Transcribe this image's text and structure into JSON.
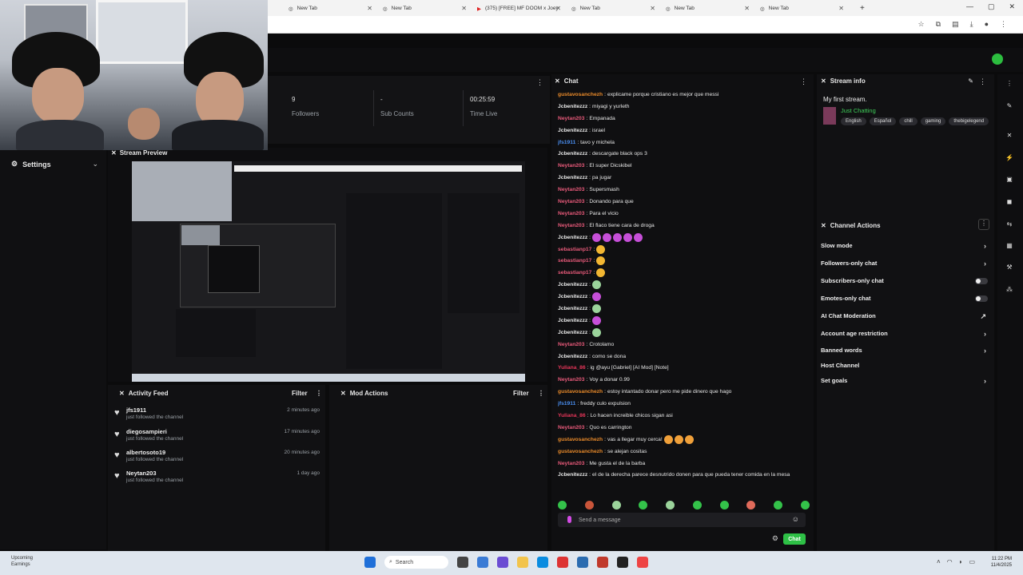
{
  "browser": {
    "tabs": [
      {
        "label": "New Tab",
        "icon": "globe-icon"
      },
      {
        "label": "New Tab",
        "icon": "globe-icon"
      },
      {
        "label": "(375) [FREE] MF DOOM x Joey",
        "icon": "youtube-icon"
      },
      {
        "label": "New Tab",
        "icon": "globe-icon"
      },
      {
        "label": "New Tab",
        "icon": "globe-icon"
      },
      {
        "label": "New Tab",
        "icon": "globe-icon"
      }
    ],
    "new_tab_symbol": "+"
  },
  "stats": {
    "followers_value": "9",
    "followers_label": "Followers",
    "subs_value": "-",
    "subs_label": "Sub Counts",
    "time_value": "00:25:59",
    "time_label": "Time Live"
  },
  "sidebar": {
    "settings_label": "Settings"
  },
  "preview": {
    "title": "Stream Preview"
  },
  "activity": {
    "title": "Activity Feed",
    "filter": "Filter",
    "items": [
      {
        "name": "jfs1911",
        "sub": "just followed the channel",
        "time": "2 minutes ago"
      },
      {
        "name": "diegosampieri",
        "sub": "just followed the channel",
        "time": "17 minutes ago"
      },
      {
        "name": "albertosoto19",
        "sub": "just followed the channel",
        "time": "20 minutes ago"
      },
      {
        "name": "Neytan203",
        "sub": "just followed the channel",
        "time": "1 day ago"
      }
    ]
  },
  "mod": {
    "title": "Mod Actions",
    "filter": "Filter"
  },
  "chat": {
    "title": "Chat",
    "placeholder": "Send a message",
    "send_label": "Chat",
    "messages": [
      {
        "user": "gustavosanchezh",
        "color": "#e98a2a",
        "text": "explicame porque cristiano es mejor que messi",
        "emotes": []
      },
      {
        "user": "Jcbenitezzz",
        "color": "#e8e8e8",
        "text": "miyagi y yurleth",
        "emotes": []
      },
      {
        "user": "Neytan203",
        "color": "#e85a7a",
        "text": "Empanada",
        "emotes": []
      },
      {
        "user": "Jcbenitezzz",
        "color": "#e8e8e8",
        "text": "israel",
        "emotes": []
      },
      {
        "user": "jfs1911",
        "color": "#4a8ef0",
        "text": "tavo y michela",
        "emotes": []
      },
      {
        "user": "Jcbenitezzz",
        "color": "#e8e8e8",
        "text": "descargate black ops 3",
        "emotes": []
      },
      {
        "user": "Neytan203",
        "color": "#e85a7a",
        "text": "El super Dicskibel",
        "emotes": []
      },
      {
        "user": "Jcbenitezzz",
        "color": "#e8e8e8",
        "text": "pa jugar",
        "emotes": []
      },
      {
        "user": "Neytan203",
        "color": "#e85a7a",
        "text": "Supersmash",
        "emotes": []
      },
      {
        "user": "Neytan203",
        "color": "#e85a7a",
        "text": "Donando para que",
        "emotes": []
      },
      {
        "user": "Neytan203",
        "color": "#e85a7a",
        "text": "Para el vicio",
        "emotes": []
      },
      {
        "user": "Neytan203",
        "color": "#e85a7a",
        "text": "El flaco tiene cara de droga",
        "emotes": []
      },
      {
        "user": "Jcbenitezzz",
        "color": "#e8e8e8",
        "text": "",
        "emotes": [
          "#c64fd8",
          "#c64fd8",
          "#c64fd8",
          "#c64fd8",
          "#c64fd8"
        ]
      },
      {
        "user": "sebastianp17",
        "color": "#e85a7a",
        "text": "",
        "emotes": [
          "#f2b632"
        ]
      },
      {
        "user": "sebastianp17",
        "color": "#e85a7a",
        "text": "",
        "emotes": [
          "#f2b632"
        ]
      },
      {
        "user": "sebastianp17",
        "color": "#e85a7a",
        "text": "",
        "emotes": [
          "#f2b632"
        ]
      },
      {
        "user": "Jcbenitezzz",
        "color": "#e8e8e8",
        "text": "",
        "emotes": [
          "#9bd39b"
        ]
      },
      {
        "user": "Jcbenitezzz",
        "color": "#e8e8e8",
        "text": "",
        "emotes": [
          "#c64fd8"
        ]
      },
      {
        "user": "Jcbenitezzz",
        "color": "#e8e8e8",
        "text": "",
        "emotes": [
          "#9bd39b"
        ]
      },
      {
        "user": "Jcbenitezzz",
        "color": "#e8e8e8",
        "text": "",
        "emotes": [
          "#c64fd8"
        ]
      },
      {
        "user": "Jcbenitezzz",
        "color": "#e8e8e8",
        "text": "",
        "emotes": [
          "#9bd39b"
        ]
      },
      {
        "user": "Neytan203",
        "color": "#e85a7a",
        "text": "Crotolamo",
        "emotes": []
      },
      {
        "user": "Jcbenitezzz",
        "color": "#e8e8e8",
        "text": "como se dona",
        "emotes": []
      },
      {
        "user": "Yuliana_86",
        "color": "#e8365a",
        "text": "ig @ayu [Gabriel] [AI Mod] [Note]",
        "emotes": []
      },
      {
        "user": "Neytan203",
        "color": "#e85a7a",
        "text": "Voy a donar 0.99",
        "emotes": []
      },
      {
        "user": "gustavosanchezh",
        "color": "#e98a2a",
        "text": "estoy intantado donar pero me pide dinero que hago",
        "emotes": []
      },
      {
        "user": "jfs1911",
        "color": "#4a8ef0",
        "text": "freddy culo expulsion",
        "emotes": []
      },
      {
        "user": "Yuliana_86",
        "color": "#e8365a",
        "text": "Lo hacen increible chicos sigan asi",
        "emotes": []
      },
      {
        "user": "Neytan203",
        "color": "#e85a7a",
        "text": "Quo es carrington",
        "emotes": []
      },
      {
        "user": "gustavosanchezh",
        "color": "#e98a2a",
        "text": "vas a llegar muy cerca!",
        "emotes": [
          "#f0a03a",
          "#f0a03a",
          "#f0a03a"
        ]
      },
      {
        "user": "gustavosanchezh",
        "color": "#e98a2a",
        "text": "se alejan cositas",
        "emotes": []
      },
      {
        "user": "Neytan203",
        "color": "#e85a7a",
        "text": "Me gusta el de la barba",
        "emotes": []
      },
      {
        "user": "Jcbenitezzz",
        "color": "#e8e8e8",
        "text": "el de la derecha parece desnutrido donen para que pueda tener comida en la mesa",
        "emotes": []
      }
    ],
    "emote_bar": [
      "#34c24a",
      "#c9553a",
      "#9bd39b",
      "#34c24a",
      "#9bd39b",
      "#34c24a",
      "#34c24a",
      "#e06a5a",
      "#34c24a",
      "#34c24a"
    ]
  },
  "stream_info": {
    "title": "Stream info",
    "stream_title": "My first stream.",
    "category": "Just Chatting",
    "tags": [
      "English",
      "Español",
      "chill",
      "gaming",
      "thebigelegend"
    ]
  },
  "channel_actions": {
    "title": "Channel Actions",
    "items": [
      {
        "label": "Slow mode",
        "control": "chevron"
      },
      {
        "label": "Followers-only chat",
        "control": "chevron"
      },
      {
        "label": "Subscribers-only chat",
        "control": "toggle"
      },
      {
        "label": "Emotes-only chat",
        "control": "toggle"
      },
      {
        "label": "AI Chat Moderation",
        "control": "external"
      },
      {
        "label": "Account age restriction",
        "control": "chevron"
      },
      {
        "label": "Banned words",
        "control": "chevron"
      },
      {
        "label": "Host Channel",
        "control": "none"
      },
      {
        "label": "Set goals",
        "control": "chevron"
      }
    ]
  },
  "taskbar": {
    "weather_line1": "Upcoming",
    "weather_line2": "Earnings",
    "search_label": "Search",
    "clock_time": "11:22 PM",
    "clock_date": "11/4/2025"
  }
}
